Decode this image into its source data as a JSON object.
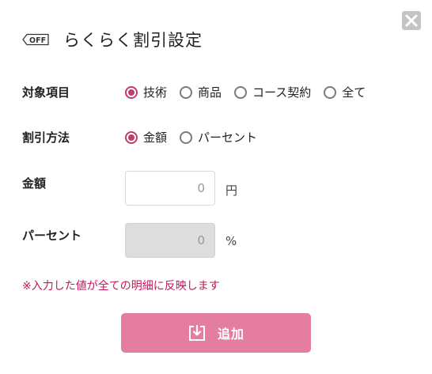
{
  "dialog": {
    "off_tag": "OFF",
    "title": "らくらく割引設定",
    "close_icon": "close-icon"
  },
  "target": {
    "label": "対象項目",
    "options": [
      "技術",
      "商品",
      "コース契約",
      "全て"
    ],
    "selected": "技術"
  },
  "method": {
    "label": "割引方法",
    "options": [
      "金額",
      "パーセント"
    ],
    "selected": "金額"
  },
  "amount": {
    "label": "金額",
    "value": "0",
    "unit": "円",
    "disabled": false
  },
  "percent": {
    "label": "パーセント",
    "value": "0",
    "unit": "%",
    "disabled": true
  },
  "note": "※入力した値が全ての明細に反映します",
  "add_button": {
    "label": "追加",
    "icon": "download-tray-icon"
  },
  "colors": {
    "accent": "#c23b6e",
    "note": "#c2185b",
    "button": "#e47d9f",
    "close_bg": "#c4c4c4"
  }
}
